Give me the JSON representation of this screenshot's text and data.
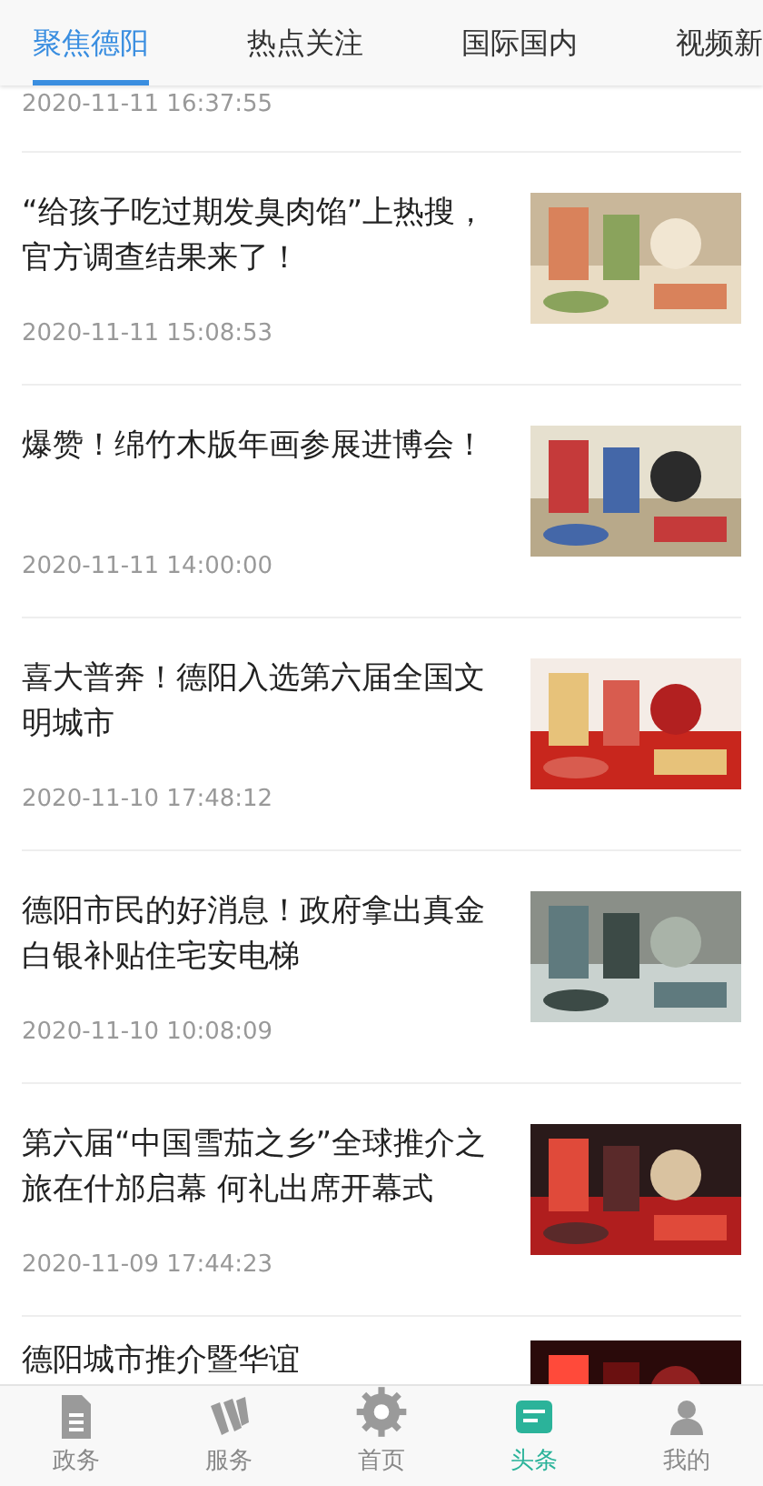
{
  "tabs": [
    {
      "label": "聚焦德阳",
      "selected": true
    },
    {
      "label": "热点关注",
      "selected": false
    },
    {
      "label": "国际国内",
      "selected": false
    },
    {
      "label": "视频新",
      "selected": false
    }
  ],
  "top_date": "2020-11-11 16:37:55",
  "articles": [
    {
      "title": "“给孩子吃过期发臭肉馅”上热搜，官方调查结果来了！",
      "date": "2020-11-11 15:08:53"
    },
    {
      "title": "爆赞！绵竹木版年画参展进博会！",
      "date": "2020-11-11 14:00:00"
    },
    {
      "title": "喜大普奔！德阳入选第六届全国文明城市",
      "date": "2020-11-10 17:48:12"
    },
    {
      "title": "德阳市民的好消息！政府拿出真金白银补贴住宅安电梯",
      "date": "2020-11-10 10:08:09"
    },
    {
      "title": "第六届“中国雪茄之乡”全球推介之旅在什邡启幕 何礼出席开幕式",
      "date": "2020-11-09 17:44:23"
    },
    {
      "title": "德阳城市推介暨华谊"
    }
  ],
  "nav": [
    {
      "label": "政务",
      "kind": "doc",
      "selected": false
    },
    {
      "label": "服务",
      "kind": "service",
      "selected": false
    },
    {
      "label": "首页",
      "kind": "home",
      "selected": false
    },
    {
      "label": "头条",
      "kind": "news",
      "selected": true
    },
    {
      "label": "我的",
      "kind": "user",
      "selected": false
    }
  ]
}
